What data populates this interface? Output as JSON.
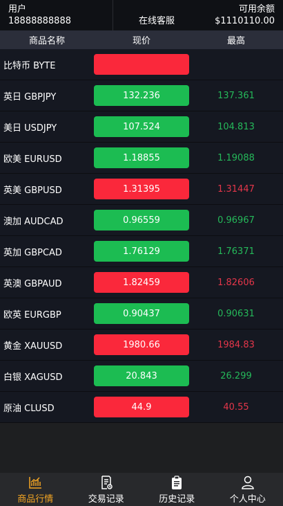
{
  "header": {
    "user_label": "用户",
    "user_value": "18888888888",
    "service_label": "在线客服",
    "balance_label": "可用余额",
    "balance_value": "$1110110.00"
  },
  "columns": {
    "name": "商品名称",
    "price": "现价",
    "high": "最高"
  },
  "rows": [
    {
      "name": "比特币 BYTE",
      "price": "",
      "high": "",
      "dir": "down"
    },
    {
      "name": "英日 GBPJPY",
      "price": "132.236",
      "high": "137.361",
      "dir": "up"
    },
    {
      "name": "美日 USDJPY",
      "price": "107.524",
      "high": "104.813",
      "dir": "up"
    },
    {
      "name": "欧美 EURUSD",
      "price": "1.18855",
      "high": "1.19088",
      "dir": "up"
    },
    {
      "name": "英美 GBPUSD",
      "price": "1.31395",
      "high": "1.31447",
      "dir": "down"
    },
    {
      "name": "澳加 AUDCAD",
      "price": "0.96559",
      "high": "0.96967",
      "dir": "up"
    },
    {
      "name": "英加 GBPCAD",
      "price": "1.76129",
      "high": "1.76371",
      "dir": "up"
    },
    {
      "name": "英澳 GBPAUD",
      "price": "1.82459",
      "high": "1.82606",
      "dir": "down"
    },
    {
      "name": "欧英 EURGBP",
      "price": "0.90437",
      "high": "0.90631",
      "dir": "up"
    },
    {
      "name": "黄金 XAUUSD",
      "price": "1980.66",
      "high": "1984.83",
      "dir": "down"
    },
    {
      "name": "白银 XAGUSD",
      "price": "20.843",
      "high": "26.299",
      "dir": "up"
    },
    {
      "name": "原油 CLUSD",
      "price": "44.9",
      "high": "40.55",
      "dir": "down"
    }
  ],
  "tabs": [
    {
      "label": "商品行情",
      "icon": "chart-icon",
      "active": true
    },
    {
      "label": "交易记录",
      "icon": "document-icon",
      "active": false
    },
    {
      "label": "历史记录",
      "icon": "clipboard-icon",
      "active": false
    },
    {
      "label": "个人中心",
      "icon": "user-icon",
      "active": false
    }
  ],
  "colors": {
    "up": "#1cbc52",
    "down": "#fa283b",
    "active_tab": "#f5a623"
  }
}
